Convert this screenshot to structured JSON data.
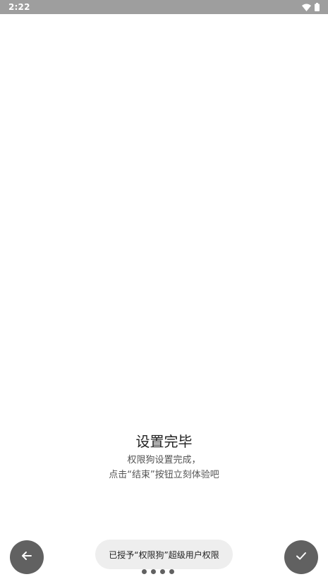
{
  "status_bar": {
    "time": "2:22",
    "icons": [
      "wifi-icon",
      "battery-icon"
    ]
  },
  "main": {
    "title": "设置完毕",
    "description_lines": [
      "权限狗设置完成，",
      "点击“结束”按钮立刻体验吧"
    ]
  },
  "navigation": {
    "back_icon": "arrow-left-icon",
    "finish_icon": "check-icon",
    "page_count": 4
  },
  "toast": {
    "message": "已授予“权限狗”超级用户权限"
  },
  "colors": {
    "status_bar": "#9e9e9e",
    "button": "#616161",
    "toast_bg": "#eeeeee"
  }
}
